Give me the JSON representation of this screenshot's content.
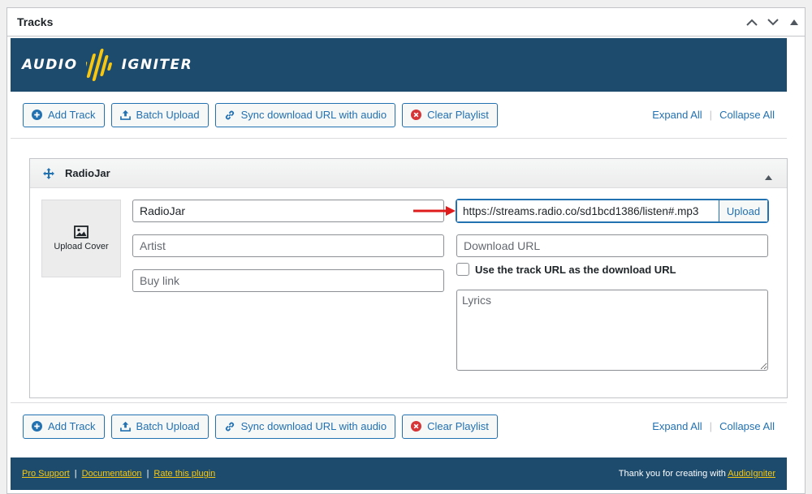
{
  "metabox": {
    "title": "Tracks"
  },
  "brand": {
    "left": "AUDIO",
    "right": "IGNITER",
    "logo_color": "#f9c80e",
    "bar_color": "#1d4b6e"
  },
  "toolbar": {
    "add_track": "Add Track",
    "batch_upload": "Batch Upload",
    "sync_download": "Sync download URL with audio",
    "clear_playlist": "Clear Playlist",
    "expand_all": "Expand All",
    "collapse_all": "Collapse All"
  },
  "track": {
    "header_title": "RadioJar",
    "cover_label": "Upload Cover",
    "title_value": "RadioJar",
    "artist_placeholder": "Artist",
    "buy_link_placeholder": "Buy link",
    "track_url_value": "https://streams.radio.co/sd1bcd1386/listen#.mp3",
    "upload_label": "Upload",
    "download_url_placeholder": "Download URL",
    "use_track_url_label": "Use the track URL as the download URL",
    "lyrics_placeholder": "Lyrics"
  },
  "footer": {
    "pro_support": "Pro Support",
    "documentation": "Documentation",
    "rate_plugin": "Rate this plugin",
    "thanks_text": "Thank you for creating with ",
    "thanks_link": "AudioIgniter"
  },
  "colors": {
    "accent": "#2271b1",
    "clear_icon": "#d63638",
    "arrow": "#e01b1b",
    "footer_link": "#f9c80e"
  }
}
